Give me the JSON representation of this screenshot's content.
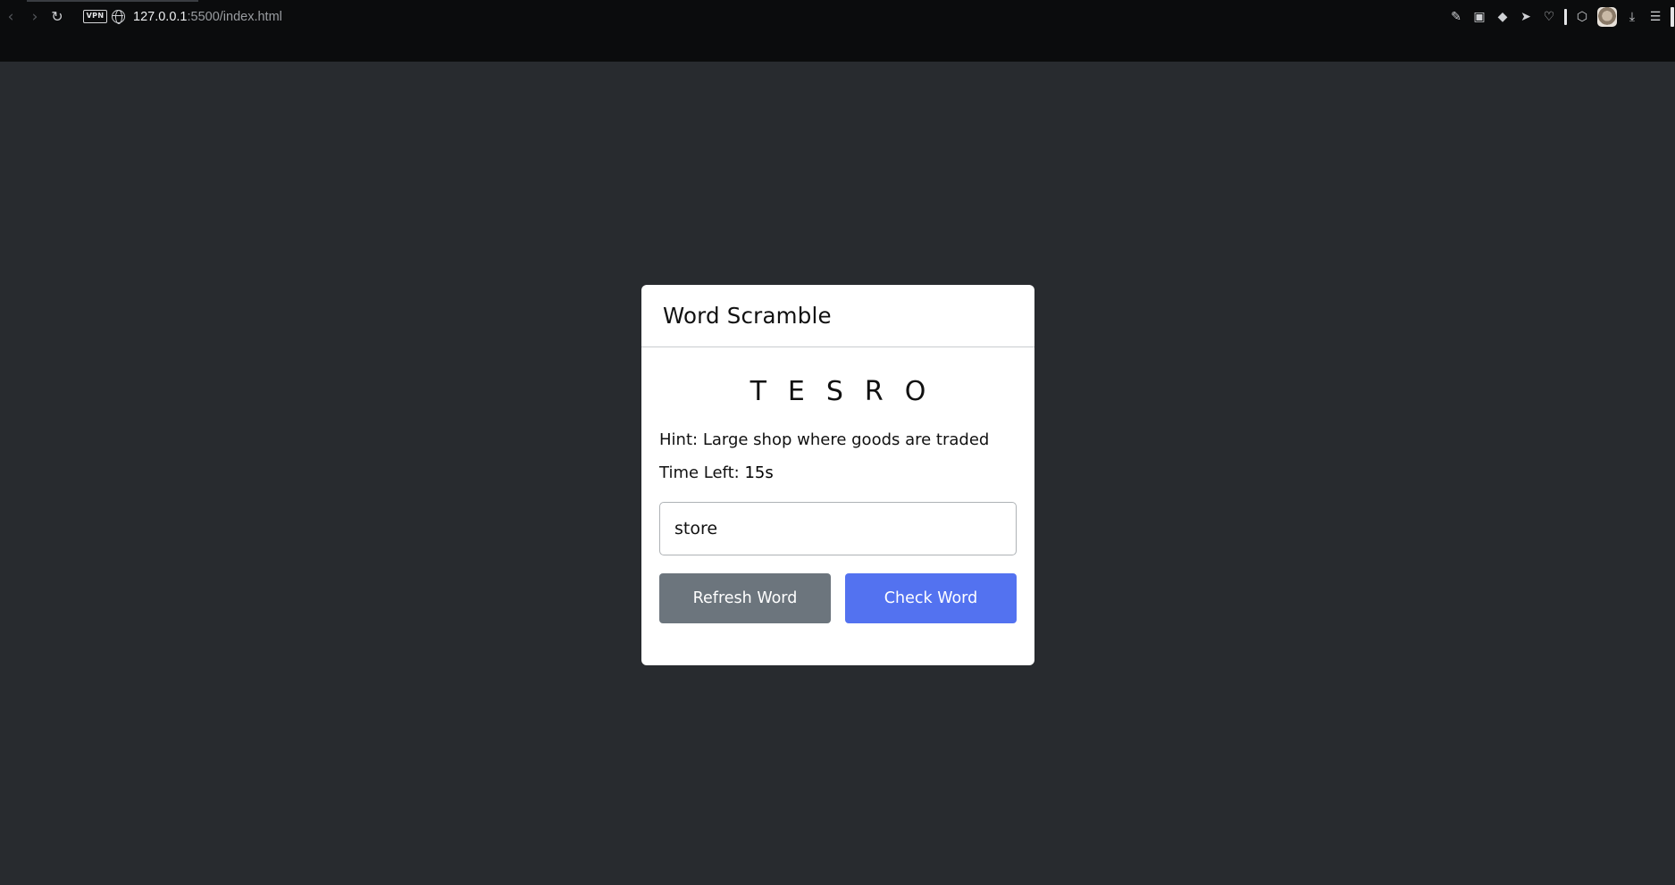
{
  "browser": {
    "url_host": "127.0.0.1",
    "url_rest": ":5500/index.html",
    "vpn_label": "VPN",
    "back_icon": "back-arrow-icon",
    "forward_icon": "forward-arrow-icon",
    "reload_icon": "reload-icon",
    "toolbar_icons": [
      "edit-icon",
      "camera-icon",
      "shield-icon",
      "send-icon",
      "heart-icon",
      "cube-icon",
      "avatar",
      "download-icon",
      "menu-icon"
    ]
  },
  "game": {
    "title": "Word Scramble",
    "scrambled_word": "TESRO",
    "hint_label": "Hint:",
    "hint_text": "Large shop where goods are traded",
    "time_label": "Time Left:",
    "time_value": "15",
    "time_unit": "s",
    "input_value": "store",
    "refresh_label": "Refresh Word",
    "check_label": "Check Word"
  },
  "colors": {
    "background": "#282b2f",
    "card": "#ffffff",
    "refresh_button": "#6c757d",
    "check_button": "#5372f0"
  }
}
